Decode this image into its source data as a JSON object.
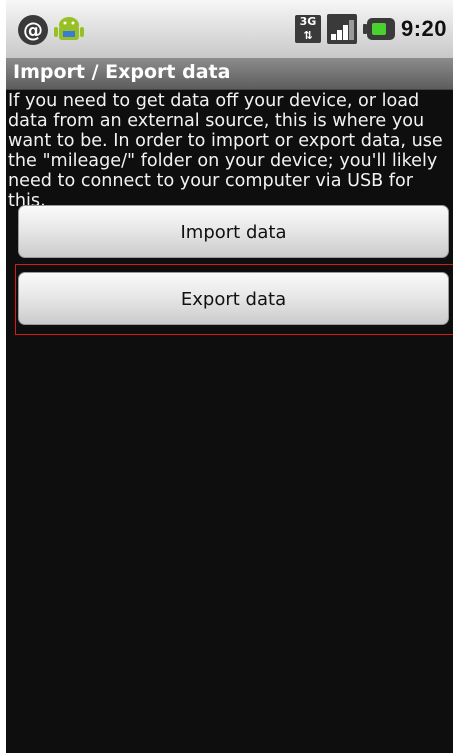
{
  "status_bar": {
    "time": "9:20",
    "network_type": "3G"
  },
  "screen": {
    "title": "Import / Export data",
    "description": "If you need to get data off your device, or load data from an external source, this is where you want to be. In order to import or export data, use the \"mileage/\" folder on your device; you'll likely need to connect to your computer via USB for this."
  },
  "buttons": {
    "import_label": "Import data",
    "export_label": "Export data"
  }
}
